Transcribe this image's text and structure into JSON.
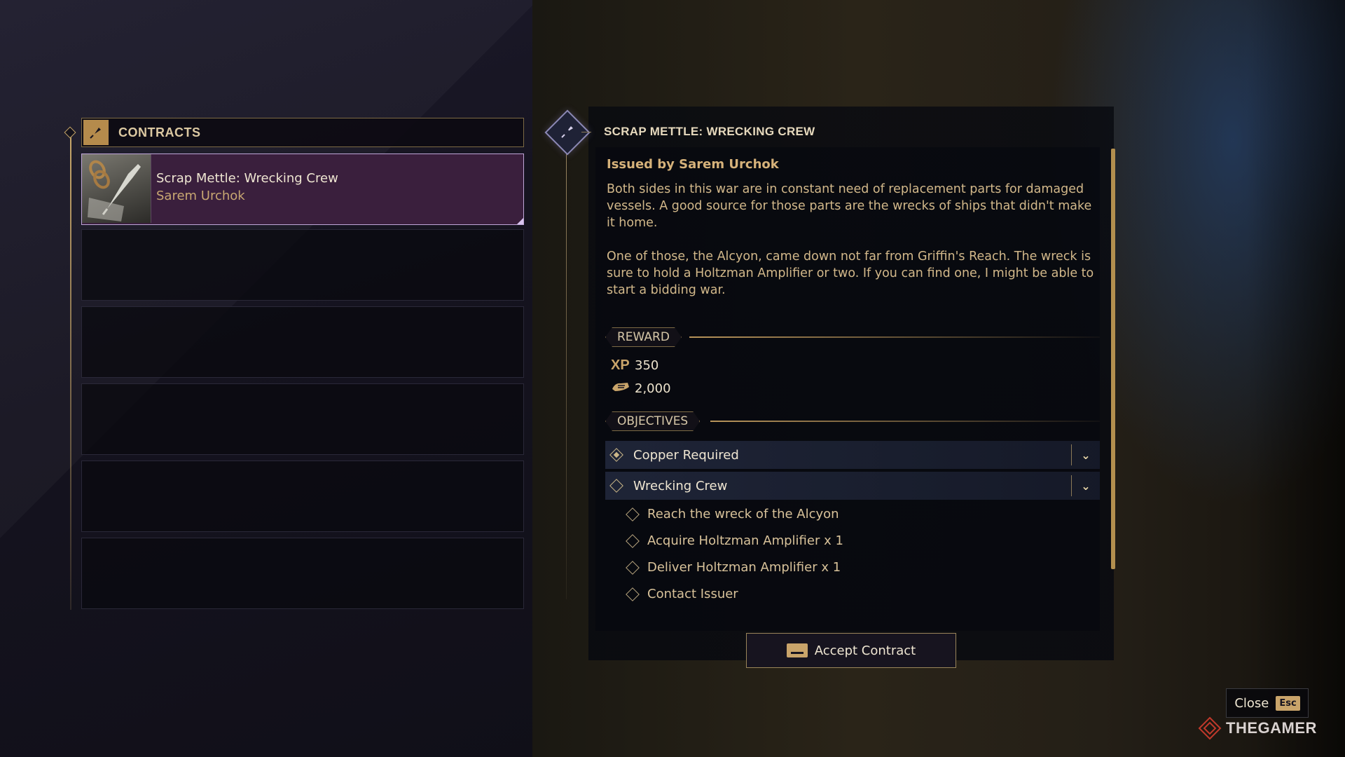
{
  "contracts_panel": {
    "title": "CONTRACTS",
    "header_icon": "quill-pen-icon",
    "items": [
      {
        "title": "Scrap Mettle: Wrecking Crew",
        "issuer": "Sarem Urchok",
        "thumbnail_icon": "chain-quill-icon"
      }
    ]
  },
  "detail": {
    "title": "SCRAP METTLE: WRECKING CREW",
    "badge_icon": "quill-pen-icon",
    "issued_by": "Issued by Sarem Urchok",
    "description": [
      "Both sides in this war are in constant need of replacement parts for damaged vessels. A good source for those parts are the wrecks of ships that didn't make it home.",
      "One of those, the Alcyon, came down not far from Griffin's Reach. The wreck is sure to hold a Holtzman Amplifier or two. If you can find one, I might be able to start a bidding war."
    ],
    "reward": {
      "label": "REWARD",
      "items": [
        {
          "icon": "xp-icon",
          "icon_text": "XP",
          "value": "350"
        },
        {
          "icon": "solari-currency-icon",
          "value": "2,000"
        }
      ]
    },
    "objectives": {
      "label": "OBJECTIVES",
      "main": [
        {
          "label": "Copper Required"
        },
        {
          "label": "Wrecking Crew"
        }
      ],
      "sub": [
        {
          "label": "Reach the wreck of the Alcyon"
        },
        {
          "label": "Acquire Holtzman Amplifier x 1"
        },
        {
          "label": "Deliver Holtzman Amplifier x 1"
        },
        {
          "label": "Contact Issuer"
        }
      ]
    },
    "accept_label": "Accept Contract"
  },
  "close": {
    "label": "Close",
    "key": "Esc"
  },
  "watermark": "THEGAMER",
  "colors": {
    "accent": "#c9a46a",
    "selected_bg": "#3a1f3d",
    "selected_border": "#bfa6d8"
  }
}
